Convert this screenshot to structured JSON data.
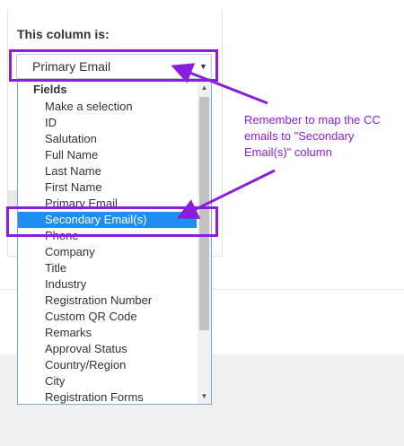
{
  "panel": {
    "column_label": "This column is:",
    "select_value": "Primary Email",
    "select_arrow_icon": "▼"
  },
  "dropdown": {
    "group_header": "Fields",
    "options": [
      "Make a selection",
      "ID",
      "Salutation",
      "Full Name",
      "Last Name",
      "First Name",
      "Primary Email",
      "Secondary Email(s)",
      "Phone",
      "Company",
      "Title",
      "Industry",
      "Registration Number",
      "Custom QR Code",
      "Remarks",
      "Approval Status",
      "Country/Region",
      "City",
      "Registration Forms"
    ],
    "selected_option": "Secondary Email(s)",
    "scroll_up_icon": "▲",
    "scroll_down_icon": "▼"
  },
  "annotation": {
    "callout": "Remember to map the CC emails to \"Secondary Email(s)\" column",
    "color": "#8a1de0"
  },
  "colors": {
    "selected_bg": "#1e8ff0",
    "dropdown_border": "#7aa7e0"
  }
}
